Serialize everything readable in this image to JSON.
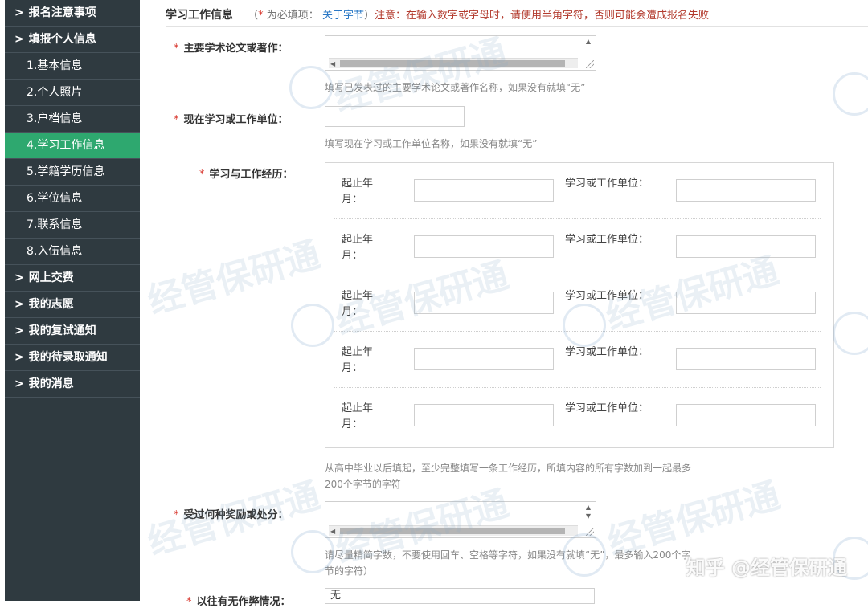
{
  "sidebar": {
    "items": [
      {
        "label": "报名注意事项",
        "type": "group"
      },
      {
        "label": "填报个人信息",
        "type": "group"
      },
      {
        "label": "1.基本信息",
        "type": "sub"
      },
      {
        "label": "2.个人照片",
        "type": "sub"
      },
      {
        "label": "3.户档信息",
        "type": "sub"
      },
      {
        "label": "4.学习工作信息",
        "type": "sub",
        "active": true
      },
      {
        "label": "5.学籍学历信息",
        "type": "sub"
      },
      {
        "label": "6.学位信息",
        "type": "sub"
      },
      {
        "label": "7.联系信息",
        "type": "sub"
      },
      {
        "label": "8.入伍信息",
        "type": "sub"
      },
      {
        "label": "网上交费",
        "type": "group"
      },
      {
        "label": "我的志愿",
        "type": "group"
      },
      {
        "label": "我的复试通知",
        "type": "group"
      },
      {
        "label": "我的待录取通知",
        "type": "group"
      },
      {
        "label": "我的消息",
        "type": "group"
      }
    ],
    "chevron": ">"
  },
  "header": {
    "title": "学习工作信息",
    "paren_open": "（",
    "star": "*",
    "required_note": "为必填项：",
    "link": "关于字节",
    "paren_close": "）",
    "warning": "注意：在输入数字或字母时，请使用半角字符，否则可能会遭成报名失败"
  },
  "fields": {
    "papers": {
      "label": "主要学术论文或著作：",
      "hint": "填写已发表过的主要学术论文或著作名称，如果没有就填“无”"
    },
    "unit": {
      "label": "现在学习或工作单位：",
      "value": "",
      "hint": "填写现在学习或工作单位名称，如果没有就填“无”"
    },
    "history": {
      "label": "学习与工作经历：",
      "period_label": "起止年月：",
      "unit_label": "学习或工作单位：",
      "rows": [
        {
          "period": "",
          "unit": ""
        },
        {
          "period": "",
          "unit": ""
        },
        {
          "period": "",
          "unit": ""
        },
        {
          "period": "",
          "unit": ""
        },
        {
          "period": "",
          "unit": ""
        }
      ],
      "hint_line1": "从高中毕业以后填起，至少完整填写一条工作经历，所填内容的所有字数加到一起最多",
      "hint_line2": "200个字节的字符"
    },
    "awards": {
      "label": "受过何种奖励或处分：",
      "hint_line1": "请尽量精简字数，不要使用回车、空格等字符，如果没有就填“无”，最多输入200个字",
      "hint_line2": "节的字符）"
    },
    "discipline": {
      "label": "以往有无作弊情况：",
      "value": "无"
    }
  },
  "watermark": {
    "text": "经管保研通",
    "site": "知乎 @经管保研通"
  }
}
